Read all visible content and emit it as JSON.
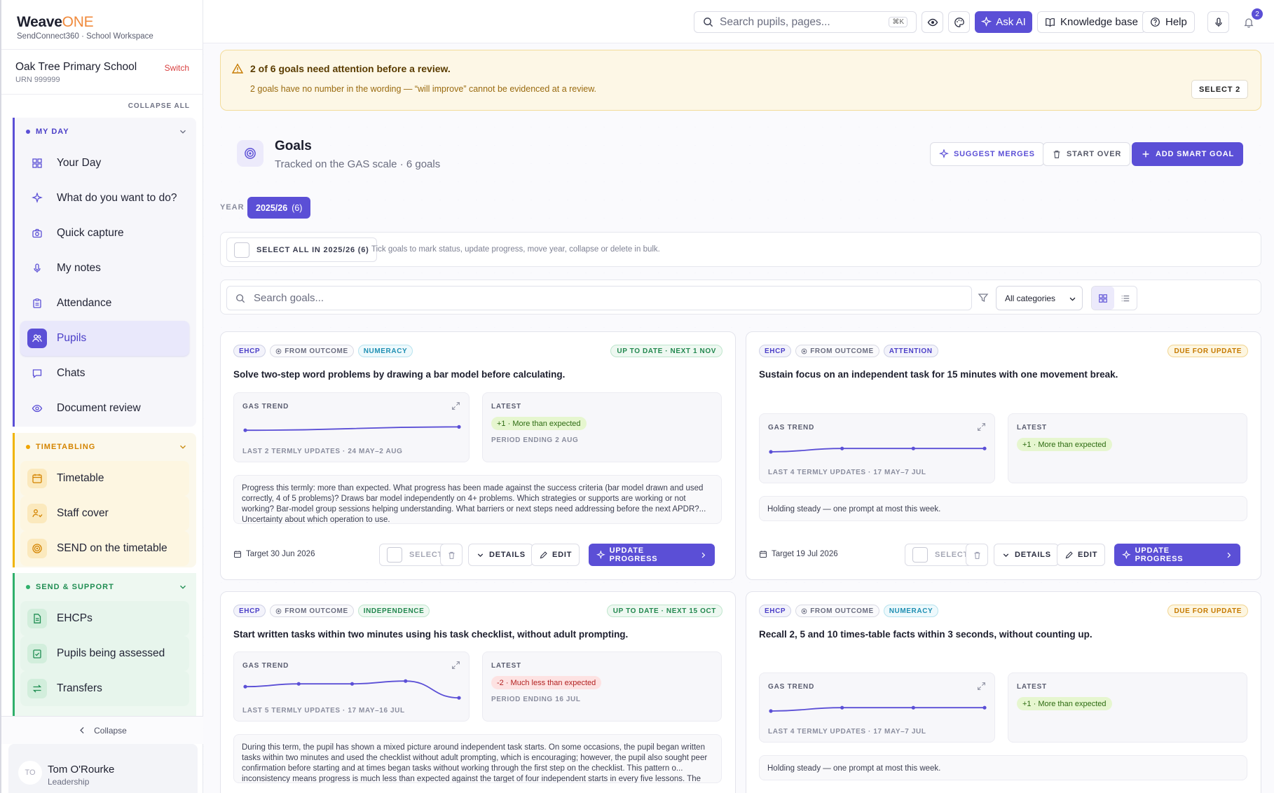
{
  "brand": {
    "name_main": "Weave",
    "name_accent": "ONE",
    "subtitle": "SendConnect360 · School Workspace"
  },
  "school": {
    "name": "Oak Tree Primary School",
    "urn": "URN 999999",
    "switch_label": "Switch"
  },
  "sidebar": {
    "collapse_all": "COLLAPSE ALL",
    "my_day": {
      "label": "MY DAY",
      "items": [
        "Your Day",
        "What do you want to do?",
        "Quick capture",
        "My notes",
        "Attendance",
        "Pupils",
        "Chats",
        "Document review"
      ]
    },
    "timetabling": {
      "label": "TIMETABLING",
      "items": [
        "Timetable",
        "Staff cover",
        "SEND on the timetable"
      ]
    },
    "send_support": {
      "label": "SEND & SUPPORT",
      "items": [
        "EHCPs",
        "Pupils being assessed",
        "Transfers"
      ]
    },
    "collapse_label": "Collapse",
    "user": {
      "initials": "TO",
      "name": "Tom O'Rourke",
      "role": "Leadership"
    }
  },
  "topbar": {
    "search_placeholder": "Search pupils, pages...",
    "shortcut": "⌘K",
    "ask_ai": "Ask AI",
    "knowledge_base": "Knowledge base",
    "help": "Help",
    "notifications": "2"
  },
  "alert": {
    "title": "2 of 6 goals need attention before a review.",
    "text": "2 goals have no number in the wording — “will improve” cannot be evidenced at a review.",
    "button": "SELECT 2"
  },
  "header": {
    "title": "Goals",
    "subtitle": "Tracked on the GAS scale · 6 goals",
    "suggest_merges": "SUGGEST MERGES",
    "start_over": "START OVER",
    "add_goal": "ADD SMART GOAL"
  },
  "year": {
    "label": "YEAR",
    "value": "2025/26",
    "count": "(6)"
  },
  "bulk": {
    "select_all": "SELECT ALL IN 2025/26 (6)",
    "hint": "Tick goals to mark status, update progress, move year, collapse or delete in bulk."
  },
  "filter": {
    "search_placeholder": "Search goals...",
    "category": "All categories"
  },
  "labels": {
    "gas_trend": "GAS TREND",
    "latest": "LATEST",
    "select": "SELECT",
    "details": "DETAILS",
    "edit": "EDIT",
    "update_progress": "UPDATE PROGRESS"
  },
  "goals": [
    {
      "tags": [
        "EHCP",
        "FROM OUTCOME",
        "NUMERACY"
      ],
      "status": "UP TO DATE · NEXT 1 NOV",
      "status_type": "ok",
      "title": "Solve two-step word problems by drawing a bar model before calculating.",
      "trend_meta": "LAST 2 TERMLY UPDATES · 24 MAY–2 AUG",
      "trend_values": [
        -0.4,
        0.2
      ],
      "latest": "+1 · More than expected",
      "latest_type": "pos",
      "latest_meta": "PERIOD ENDING 2 AUG",
      "note": "Progress this termly: more than expected. What progress has been made against the success criteria (bar model drawn and used correctly, 4 of 5 problems)? Draws bar model independently on 4+ problems. Which strategies or supports are working or not working? Bar-model group sessions helping understanding. What barriers or next steps need addressing before the next APDR?... Uncertainty about which operation to use.",
      "target": "Target 30 Jun 2026"
    },
    {
      "tags": [
        "EHCP",
        "FROM OUTCOME",
        "ATTENTION"
      ],
      "status": "DUE FOR UPDATE",
      "status_type": "due",
      "title": "Sustain focus on an independent task for 15 minutes with one movement break.",
      "trend_meta": "LAST 4 TERMLY UPDATES · 17 MAY–7 JUL",
      "trend_values": [
        -0.5,
        0.1,
        0.1,
        0.1
      ],
      "latest": "+1 · More than expected",
      "latest_type": "pos",
      "latest_meta": "",
      "note": "Holding steady — one prompt at most this week.",
      "target": "Target 19 Jul 2026"
    },
    {
      "tags": [
        "EHCP",
        "FROM OUTCOME",
        "INDEPENDENCE"
      ],
      "status": "UP TO DATE · NEXT 15 OCT",
      "status_type": "ok",
      "title": "Start written tasks within two minutes using his task checklist, without adult prompting.",
      "trend_meta": "LAST 5 TERMLY UPDATES · 17 MAY–16 JUL",
      "trend_values": [
        0.1,
        0.6,
        0.6,
        1.1,
        -1.9
      ],
      "latest": "-2 · Much less than expected",
      "latest_type": "neg",
      "latest_meta": "PERIOD ENDING 16 JUL",
      "note": "During this term, the pupil has shown a mixed picture around independent task starts. On some occasions, the pupil began written tasks within two minutes and used the checklist without adult prompting, which is encouraging; however, the pupil also sought peer confirmation before starting and at times began tasks without working through the first step on the checklist. This pattern o... inconsistency means progress is much less than expected against the target of four independent starts in every five lessons. The",
      "target": ""
    },
    {
      "tags": [
        "EHCP",
        "FROM OUTCOME",
        "NUMERACY"
      ],
      "status": "DUE FOR UPDATE",
      "status_type": "due",
      "title": "Recall 2, 5 and 10 times-table facts within 3 seconds, without counting up.",
      "trend_meta": "LAST 4 TERMLY UPDATES · 17 MAY–7 JUL",
      "trend_values": [
        -0.5,
        0.1,
        0.1,
        0.1
      ],
      "latest": "+1 · More than expected",
      "latest_type": "pos",
      "latest_meta": "",
      "note": "Holding steady — one prompt at most this week.",
      "target": ""
    }
  ]
}
